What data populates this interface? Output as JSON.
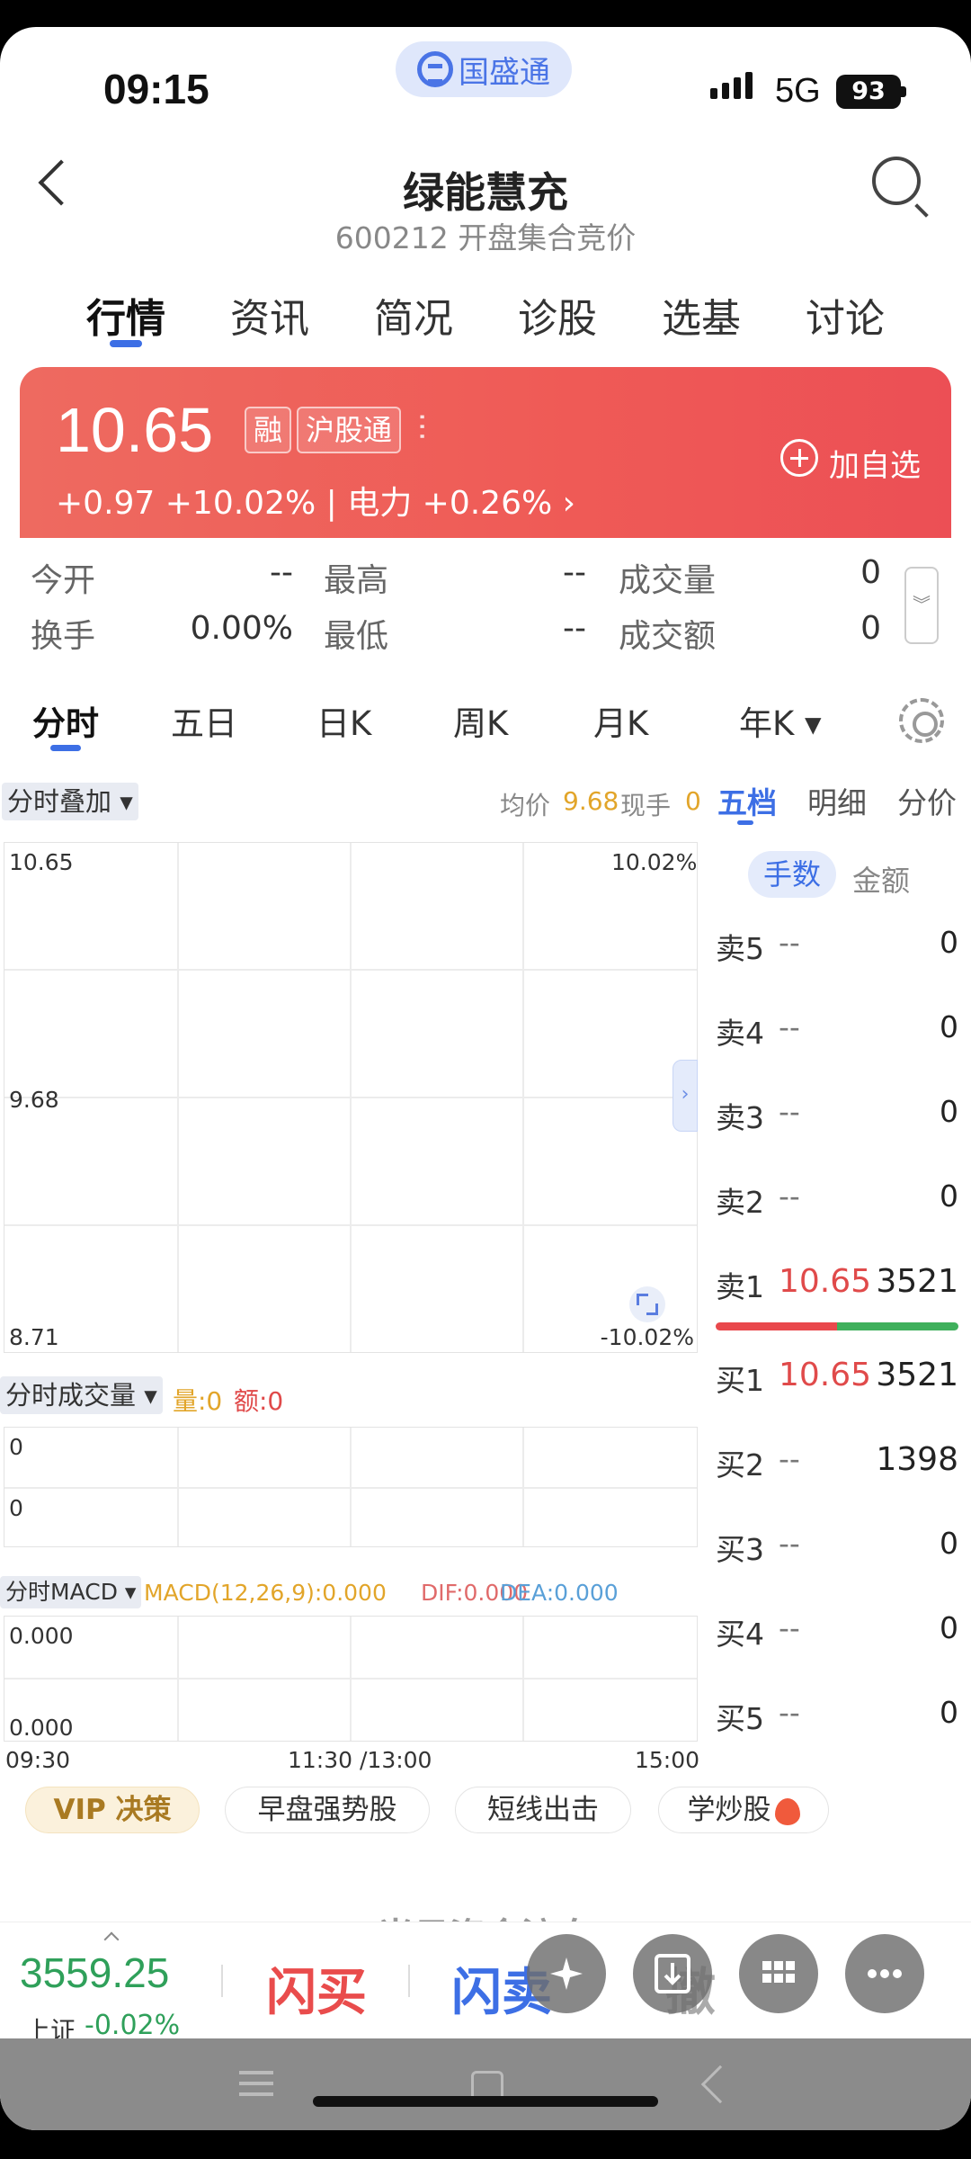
{
  "status_bar": {
    "time": "09:15",
    "brand": "国盛通",
    "network": "5G",
    "battery": "93"
  },
  "header": {
    "title": "绿能慧充",
    "subtitle": "600212 开盘集合竞价"
  },
  "tabs": [
    "行情",
    "资讯",
    "简况",
    "诊股",
    "选基",
    "讨论"
  ],
  "quote": {
    "price": "10.65",
    "tags": [
      "融",
      "沪股通"
    ],
    "change": "+0.97  +10.02% | 电力 +0.26%",
    "add_watch": "加自选"
  },
  "stats": {
    "open_label": "今开",
    "open_value": "--",
    "high_label": "最高",
    "high_value": "--",
    "volume_label": "成交量",
    "volume_value": "0",
    "turnover_label": "换手",
    "turnover_value": "0.00%",
    "low_label": "最低",
    "low_value": "--",
    "amount_label": "成交额",
    "amount_value": "0"
  },
  "kline_tabs": [
    "分时",
    "五日",
    "日K",
    "周K",
    "月K",
    "年K ▾"
  ],
  "chart": {
    "overlay_label": "分时叠加 ▾",
    "avg_label": "均价",
    "avg_value": "9.68",
    "now_hand_label": "现手",
    "now_hand_value": "0",
    "y_top": "10.65",
    "y_mid": "9.68",
    "y_bottom": "8.71",
    "pct_top": "10.02%",
    "pct_bottom": "-10.02%",
    "volume_label": "分时成交量 ▾",
    "vol_q": "量:0",
    "vol_amt": "额:0",
    "vol_y1": "0",
    "vol_y2": "0",
    "macd_label": "分时MACD ▾",
    "macd_value": "MACD(12,26,9):0.000",
    "dif_value": "DIF:0.000",
    "dea_value": "DEA:0.000",
    "macd_y1": "0.000",
    "macd_y2": "0.000",
    "x_start": "09:30",
    "x_mid": "11:30 /13:00",
    "x_end": "15:00",
    "colors": {
      "avg": "#e2a52a",
      "amount": "#e04a4a",
      "dif": "#e06a6a",
      "dea": "#5aa0d8"
    }
  },
  "order_book": {
    "tabs": [
      "五档",
      "明细",
      "分价"
    ],
    "unit_active": "手数",
    "unit_alt": "金额",
    "asks": [
      {
        "label": "卖5",
        "price": "--",
        "vol": "0"
      },
      {
        "label": "卖4",
        "price": "--",
        "vol": "0"
      },
      {
        "label": "卖3",
        "price": "--",
        "vol": "0"
      },
      {
        "label": "卖2",
        "price": "--",
        "vol": "0"
      },
      {
        "label": "卖1",
        "price": "10.65",
        "vol": "3521"
      }
    ],
    "bids": [
      {
        "label": "买1",
        "price": "10.65",
        "vol": "3521"
      },
      {
        "label": "买2",
        "price": "--",
        "vol": "1398"
      },
      {
        "label": "买3",
        "price": "--",
        "vol": "0"
      },
      {
        "label": "买4",
        "price": "--",
        "vol": "0"
      },
      {
        "label": "买5",
        "price": "--",
        "vol": "0"
      }
    ],
    "buy_ratio": 0.5
  },
  "pills": [
    "VIP 决策",
    "早盘强势股",
    "短线出击",
    "学炒股"
  ],
  "faded_section": "当日资金流向",
  "bottom": {
    "index_value": "3559.25",
    "index_name": "上证",
    "index_change": "-0.02%",
    "flash_buy": "闪买",
    "flash_sell": "闪卖",
    "cancel": "撤"
  }
}
